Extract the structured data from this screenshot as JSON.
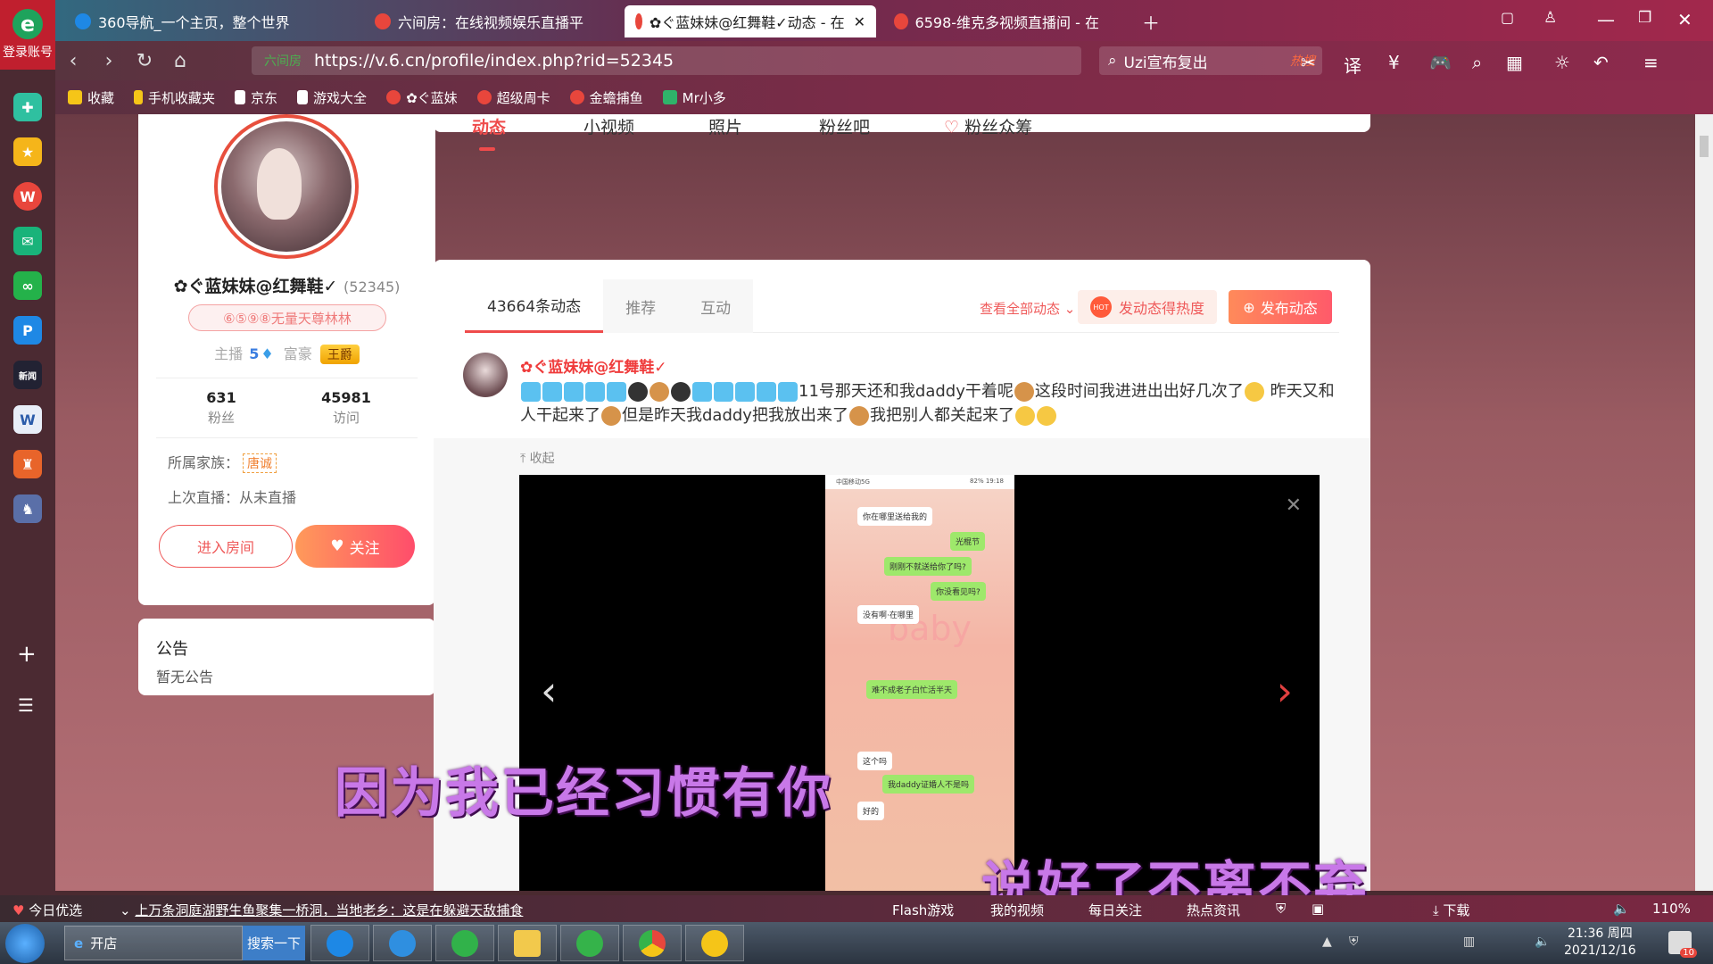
{
  "browser": {
    "login_label": "登录账号",
    "tabs": [
      {
        "title": "360导航_一个主页，整个世界",
        "color": "#f5c518"
      },
      {
        "title": "六间房：在线视频娱乐直播平",
        "color": "#e8463c"
      },
      {
        "title": "✿ぐ蓝妹妹@红舞鞋✓动态 - 在",
        "color": "#e8463c"
      },
      {
        "title": "6598-维克多视频直播间 - 在",
        "color": "#e8463c"
      }
    ],
    "url_tag": "六间房",
    "url": "https://v.6.cn/profile/index.php?rid=52345",
    "search_text": "Uzi宣布复出",
    "search_hot": "热搜",
    "bookmarks": [
      "收藏",
      "手机收藏夹",
      "京东",
      "游戏大全",
      "✿ぐ蓝妹",
      "超级周卡",
      "金蟾捕鱼",
      "Mr小多"
    ]
  },
  "profile": {
    "name": "✿ぐ蓝妹妹@红舞鞋✓",
    "rid": "(52345)",
    "badge": "⑥⑤⑨⑧无量天尊林林",
    "anchor_label": "主播",
    "anchor_level": "5",
    "rich_label": "富豪",
    "rich_title": "王爵",
    "fans_count": "631",
    "fans_label": "粉丝",
    "visits_count": "45981",
    "visits_label": "访问",
    "family_label": "所属家族：",
    "family_name": "唐诚",
    "last_live": "上次直播：从未直播",
    "enter_room": "进入房间",
    "follow": "关注"
  },
  "notice": {
    "title": "公告",
    "content": "暂无公告"
  },
  "main_tabs": [
    "动态",
    "小视频",
    "照片",
    "粉丝吧",
    "粉丝众筹"
  ],
  "feed": {
    "subtabs": [
      "43664条动态",
      "推荐",
      "互动"
    ],
    "view_all": "查看全部动态",
    "heat_button": "发动态得热度",
    "post_button": "发布动态",
    "post_author": "✿ぐ蓝妹妹@红舞鞋✓",
    "post_text_1": "11号那天还和我daddy干着呢",
    "post_text_2": "这段时间我进进出出好几次了",
    "post_text_3": "昨天又和人干起来了",
    "post_text_4": "但是昨天我daddy把我放出来了",
    "post_text_5": "我把别人都关起来了",
    "collapse": "收起"
  },
  "chat": {
    "status_left": "中国移动5G",
    "status_right": "82% 19:18",
    "messages": [
      {
        "side": "l",
        "text": "你在哪里送给我的"
      },
      {
        "side": "r",
        "text": "光棍节"
      },
      {
        "side": "r",
        "text": "刚刚不就送给你了吗?"
      },
      {
        "side": "r",
        "text": "你没看见吗?"
      },
      {
        "side": "l",
        "text": "没有啊·在哪里"
      },
      {
        "side": "r",
        "text": "难不成老子白忙活半天"
      },
      {
        "side": "l",
        "text": "这个吗"
      },
      {
        "side": "r",
        "text": "我daddy证婚人不是吗"
      },
      {
        "side": "l",
        "text": "好的"
      }
    ],
    "bg_text": "baby"
  },
  "lyrics": {
    "line1": "因为我已经习惯有你",
    "line2": "说好了不离不弃"
  },
  "statusbar": {
    "today": "今日优选",
    "news": "上万条洞庭湖野生鱼聚集一桥洞，当地老乡：这是在躲避天敌捕食",
    "flash": "Flash游戏",
    "my_video": "我的视频",
    "daily": "每日关注",
    "hot_news": "热点资讯",
    "download": "下载",
    "zoom": "110%"
  },
  "taskbar": {
    "ie_label": "开店",
    "search_label": "搜索一下",
    "time": "21:36 周四",
    "date": "2021/12/16",
    "notify_count": "10"
  }
}
